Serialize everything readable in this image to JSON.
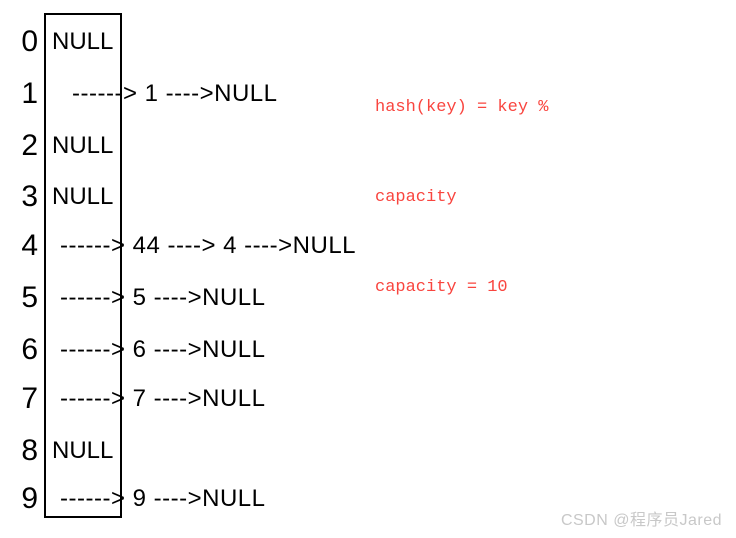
{
  "diagram": {
    "title": "hash-table-separate-chaining",
    "bucket_box": {
      "border_color": "#000000"
    },
    "rows": [
      {
        "index": "0",
        "kind": "empty",
        "text": "NULL"
      },
      {
        "index": "1",
        "kind": "chain",
        "text": "------> 1 ---->NULL"
      },
      {
        "index": "2",
        "kind": "empty",
        "text": "NULL"
      },
      {
        "index": "3",
        "kind": "empty",
        "text": "NULL"
      },
      {
        "index": "4",
        "kind": "chain",
        "text": "------> 44 ----> 4 ---->NULL"
      },
      {
        "index": "5",
        "kind": "chain",
        "text": "------> 5 ---->NULL"
      },
      {
        "index": "6",
        "kind": "chain",
        "text": "------> 6 ---->NULL"
      },
      {
        "index": "7",
        "kind": "chain",
        "text": "------> 7 ---->NULL"
      },
      {
        "index": "8",
        "kind": "empty",
        "text": "NULL"
      },
      {
        "index": "9",
        "kind": "chain",
        "text": "------> 9 ---->NULL"
      }
    ]
  },
  "formula": {
    "color": "#f9453f",
    "line1": "hash(key) = key %",
    "line2": "capacity",
    "line3": "capacity = 10"
  },
  "watermark": {
    "text": "CSDN @程序员Jared",
    "color": "#c8c8c8"
  }
}
